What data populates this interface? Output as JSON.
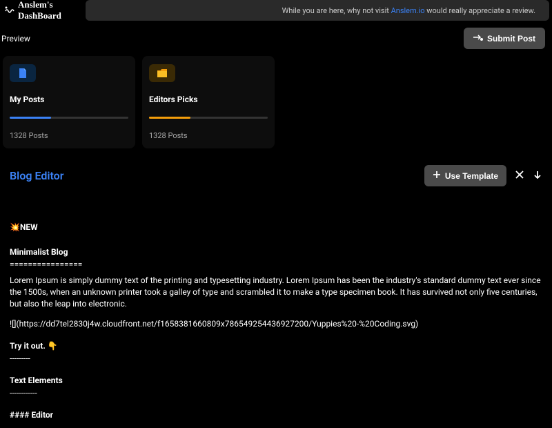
{
  "header": {
    "logo_text": "Anslem's DashBoard",
    "banner_prefix": "While you are here, why not visit ",
    "banner_link": "Anslem.io",
    "banner_suffix": " would really appreciate a review."
  },
  "subbar": {
    "preview_label": "Preview",
    "submit_label": "Submit Post"
  },
  "cards": [
    {
      "title": "My Posts",
      "count": "1328 Posts",
      "icon": "file",
      "color": "blue"
    },
    {
      "title": "Editors Picks",
      "count": "1328 Posts",
      "icon": "folder",
      "color": "amber"
    }
  ],
  "editor": {
    "title": "Blog Editor",
    "use_template_label": "Use Template",
    "content": {
      "new_label": "💥NEW",
      "heading": "Minimalist Blog",
      "heading_underline": "================",
      "body": "Lorem Ipsum is simply dummy text of the printing and typesetting industry. Lorem Ipsum has been the industry's standard dummy text ever since the 1500s, when an unknown printer took a galley of type and scrambled it to make a type specimen book. It has survived not only five centuries, but also the leap into electronic.",
      "image_ref": "![](https://dd7tel2830j4w.cloudfront.net/f1658381660809x786549254436927200/Yuppies%20-%20Coding.svg)",
      "try_it": "Try it out. 👇",
      "try_it_underline": "---------",
      "text_elements": "Text Elements",
      "text_elements_underline": "------------",
      "editor_line": "#### Editor"
    }
  }
}
